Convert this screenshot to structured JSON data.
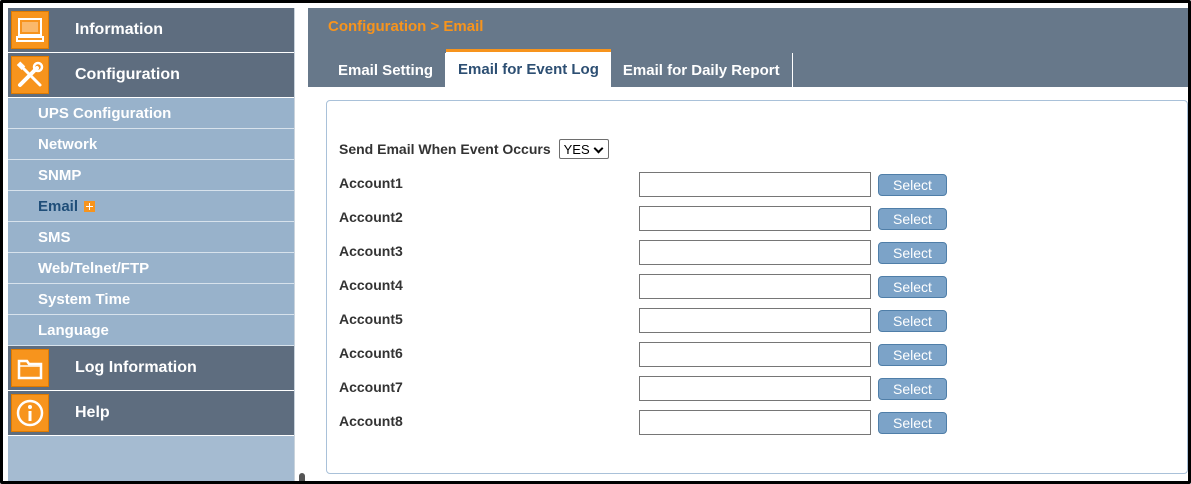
{
  "sidebar": {
    "main_items": [
      {
        "label": "Information",
        "icon": "computer-icon"
      },
      {
        "label": "Configuration",
        "icon": "tools-icon"
      },
      {
        "label": "Log Information",
        "icon": "folder-icon"
      },
      {
        "label": "Help",
        "icon": "info-icon"
      }
    ],
    "sub_items": [
      {
        "label": "UPS Configuration"
      },
      {
        "label": "Network"
      },
      {
        "label": "SNMP"
      },
      {
        "label": "Email"
      },
      {
        "label": "SMS"
      },
      {
        "label": "Web/Telnet/FTP"
      },
      {
        "label": "System Time"
      },
      {
        "label": "Language"
      }
    ],
    "active_sub_item": "Email"
  },
  "header": {
    "breadcrumb": "Configuration > Email",
    "tabs": [
      {
        "label": "Email Setting"
      },
      {
        "label": "Email for Event Log"
      },
      {
        "label": "Email for Daily Report"
      }
    ],
    "active_tab": "Email for Event Log"
  },
  "form": {
    "send_label": "Send Email When Event Occurs",
    "send_value": "YES",
    "select_button_label": "Select",
    "accounts": [
      {
        "label": "Account1",
        "value": ""
      },
      {
        "label": "Account2",
        "value": ""
      },
      {
        "label": "Account3",
        "value": ""
      },
      {
        "label": "Account4",
        "value": ""
      },
      {
        "label": "Account5",
        "value": ""
      },
      {
        "label": "Account6",
        "value": ""
      },
      {
        "label": "Account7",
        "value": ""
      },
      {
        "label": "Account8",
        "value": ""
      }
    ]
  },
  "colors": {
    "accent": "#f7941d",
    "sidebar_main_bg": "#5e6d7f",
    "sidebar_sub_bg": "#98b2cb",
    "header_bg": "#67788a",
    "button_bg": "#7ca3c8"
  }
}
